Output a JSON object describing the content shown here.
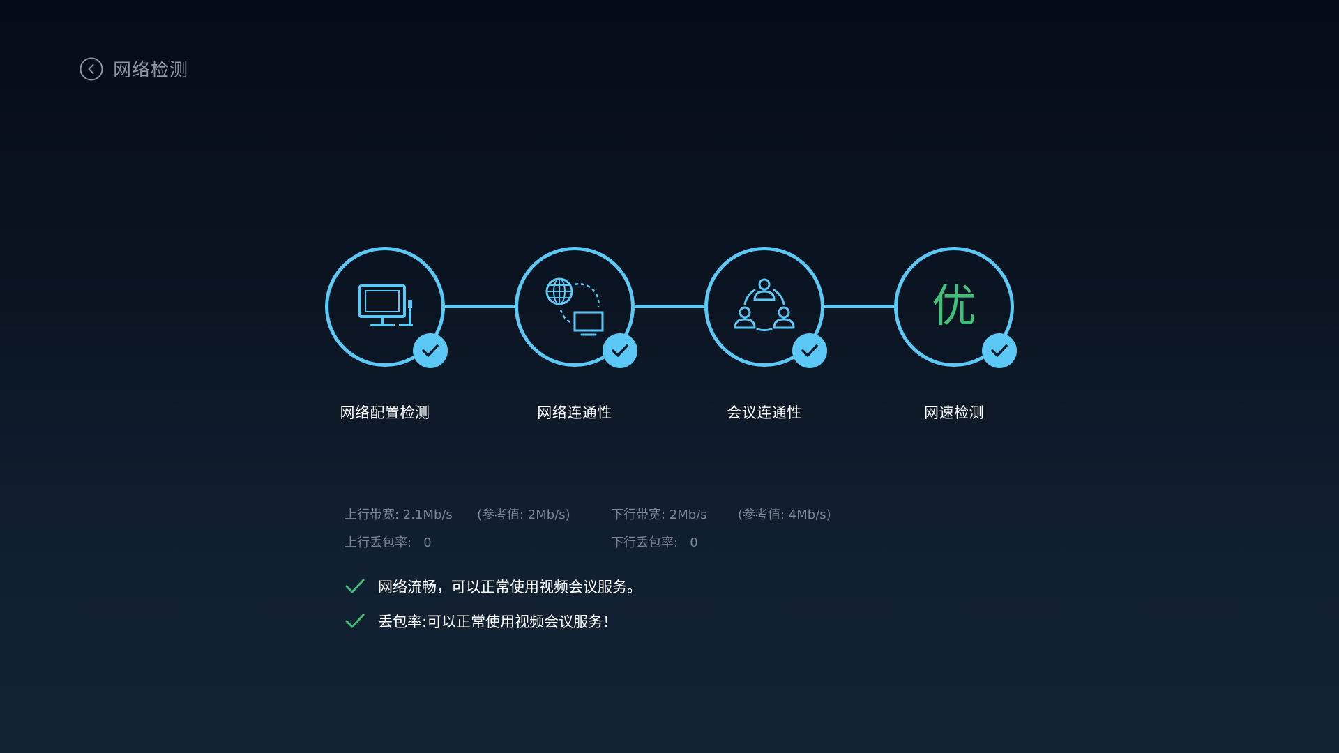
{
  "header": {
    "title": "网络检测"
  },
  "steps": [
    {
      "label": "网络配置检测",
      "icon": "computer-icon",
      "status": "passed"
    },
    {
      "label": "网络连通性",
      "icon": "globe-network-icon",
      "status": "passed"
    },
    {
      "label": "会议连通性",
      "icon": "meeting-users-icon",
      "status": "passed"
    },
    {
      "label": "网速检测",
      "grade": "优",
      "status": "passed"
    }
  ],
  "stats": {
    "upload_bandwidth": "上行带宽: 2.1Mb/s",
    "upload_reference": "(参考值: 2Mb/s)",
    "download_bandwidth": "下行带宽: 2Mb/s",
    "download_reference": "(参考值: 4Mb/s)",
    "upload_loss": "上行丢包率:   0",
    "download_loss": "下行丢包率:   0"
  },
  "results": [
    {
      "text": "网络流畅，可以正常使用视频会议服务。"
    },
    {
      "text": "丢包率:可以正常使用视频会议服务！"
    }
  ],
  "colors": {
    "accent": "#5cc8f5",
    "success": "#3fbf78",
    "muted_text": "#7e8794",
    "background": "#0b1522"
  }
}
